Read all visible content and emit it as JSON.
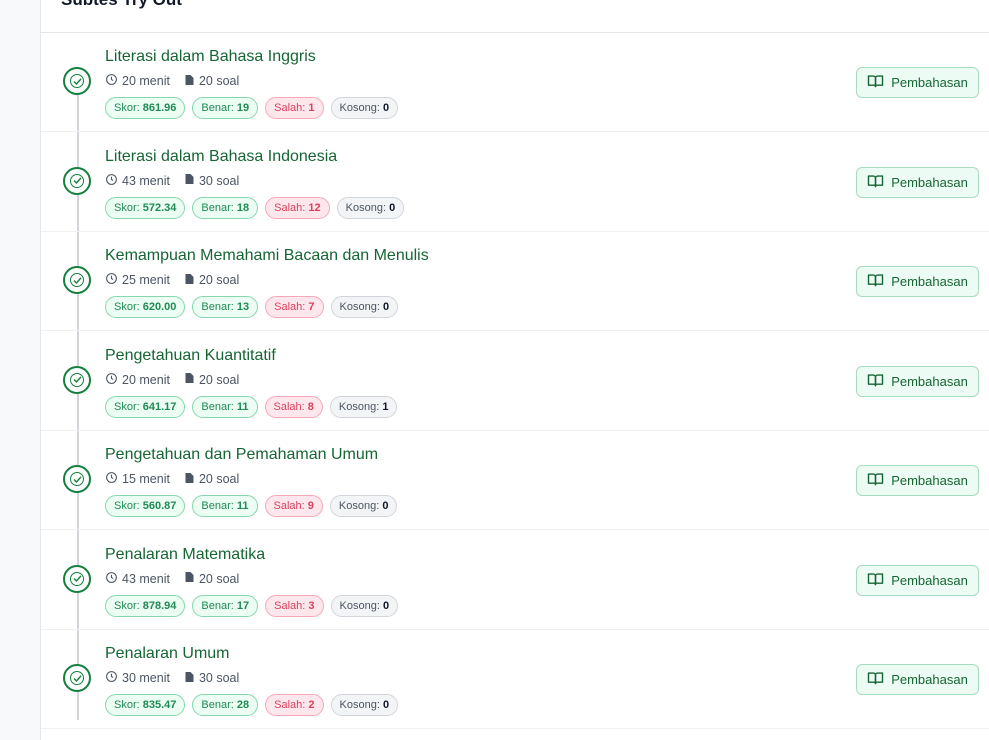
{
  "header": {
    "title": "Subtes Try Out"
  },
  "labels": {
    "skor": "Skor:",
    "benar": "Benar:",
    "salah": "Salah:",
    "kosong": "Kosong:",
    "pembahasan": "Pembahasan"
  },
  "rows": [
    {
      "title": "Literasi dalam Bahasa Inggris",
      "time": "20 menit",
      "questions": "20 soal",
      "skor": "861.96",
      "benar": "19",
      "salah": "1",
      "kosong": "0"
    },
    {
      "title": "Literasi dalam Bahasa Indonesia",
      "time": "43 menit",
      "questions": "30 soal",
      "skor": "572.34",
      "benar": "18",
      "salah": "12",
      "kosong": "0"
    },
    {
      "title": "Kemampuan Memahami Bacaan dan Menulis",
      "time": "25 menit",
      "questions": "20 soal",
      "skor": "620.00",
      "benar": "13",
      "salah": "7",
      "kosong": "0"
    },
    {
      "title": "Pengetahuan Kuantitatif",
      "time": "20 menit",
      "questions": "20 soal",
      "skor": "641.17",
      "benar": "11",
      "salah": "8",
      "kosong": "1"
    },
    {
      "title": "Pengetahuan dan Pemahaman Umum",
      "time": "15 menit",
      "questions": "20 soal",
      "skor": "560.87",
      "benar": "11",
      "salah": "9",
      "kosong": "0"
    },
    {
      "title": "Penalaran Matematika",
      "time": "43 menit",
      "questions": "20 soal",
      "skor": "878.94",
      "benar": "17",
      "salah": "3",
      "kosong": "0"
    },
    {
      "title": "Penalaran Umum",
      "time": "30 menit",
      "questions": "30 soal",
      "skor": "835.47",
      "benar": "28",
      "salah": "2",
      "kosong": "0"
    }
  ],
  "colors": {
    "accent": "#166534",
    "success": "#1f8a55",
    "danger": "#d9415f"
  },
  "icons": {
    "check": "check-circle-icon",
    "clock": "clock-icon",
    "document": "document-icon",
    "book": "book-open-icon"
  }
}
